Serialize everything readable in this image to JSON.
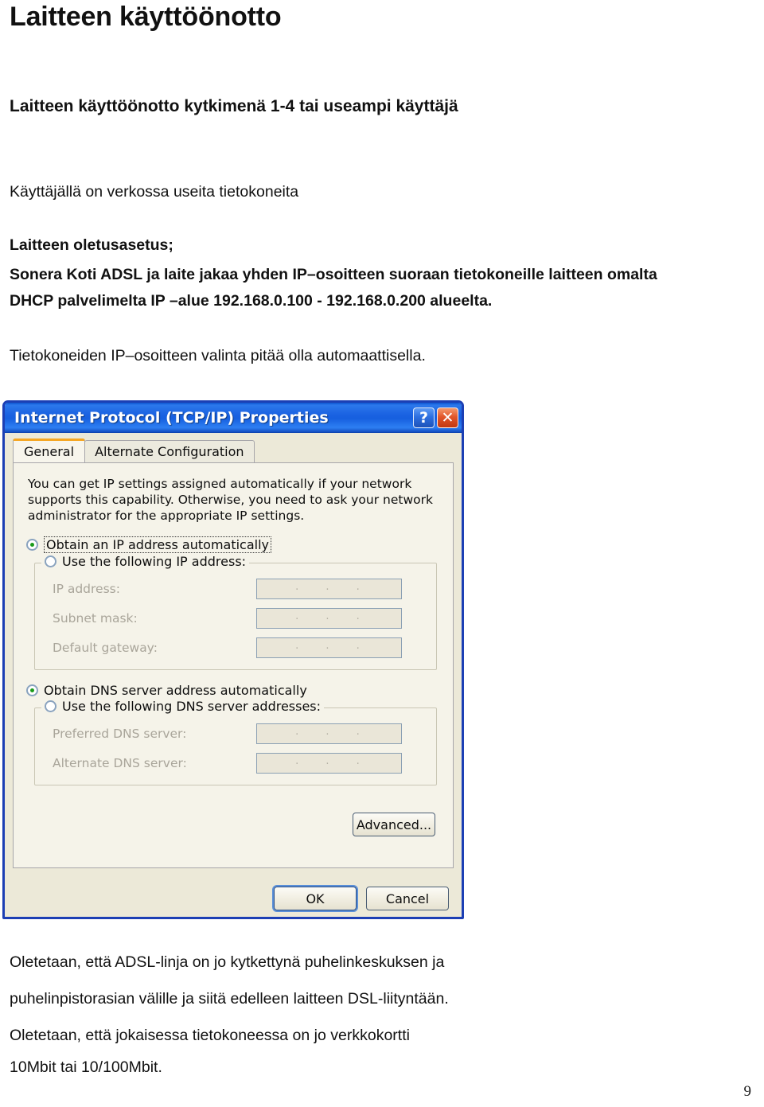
{
  "document": {
    "title": "Laitteen käyttöönotto",
    "heading": "Laitteen käyttöönotto kytkimenä 1-4 tai useampi käyttäjä",
    "paragraphs": {
      "useita": "Käyttäjällä on verkossa useita tietokoneita",
      "oletusasetus": "Laitteen oletusasetus;",
      "sonera": "Sonera Koti ADSL ja laite jakaa yhden IP–osoitteen suoraan tietokoneille  laitteen omalta",
      "dhcp": "DHCP palvelimelta IP –alue 192.168.0.100 - 192.168.0.200 alueelta.",
      "tietokoneiden": "Tietokoneiden IP–osoitteen valinta pitää olla automaattisella.",
      "bottom1": "Oletetaan, että ADSL-linja on jo kytkettynä puhelinkeskuksen ja",
      "bottom2": "puhelinpistorasian välille ja siitä edelleen laitteen DSL-liityntään.",
      "bottom3": "Oletetaan, että jokaisessa tietokoneessa on jo verkkokortti",
      "bottom4": "10Mbit tai 10/100Mbit."
    },
    "page_number": "9"
  },
  "dialog": {
    "title": "Internet Protocol (TCP/IP) Properties",
    "titlebar_buttons": {
      "help": "?",
      "close": "✕"
    },
    "tabs": [
      {
        "label": "General",
        "active": true
      },
      {
        "label": "Alternate Configuration",
        "active": false
      }
    ],
    "description": "You can get IP settings assigned automatically if your network supports this capability. Otherwise, you need to ask your network administrator for the appropriate IP settings.",
    "ip_section": {
      "obtain_auto_label": "Obtain an IP address automatically",
      "obtain_auto_selected": true,
      "use_following_label": "Use the following IP address:",
      "use_following_selected": false,
      "fields": [
        {
          "label": "IP address:",
          "value": ""
        },
        {
          "label": "Subnet mask:",
          "value": ""
        },
        {
          "label": "Default gateway:",
          "value": ""
        }
      ],
      "segment_separator": "."
    },
    "dns_section": {
      "obtain_auto_label": "Obtain DNS server address automatically",
      "obtain_auto_selected": true,
      "use_following_label": "Use the following DNS server addresses:",
      "use_following_selected": false,
      "fields": [
        {
          "label": "Preferred DNS server:",
          "value": ""
        },
        {
          "label": "Alternate DNS server:",
          "value": ""
        }
      ]
    },
    "buttons": {
      "advanced": "Advanced...",
      "ok": "OK",
      "cancel": "Cancel"
    },
    "colors": {
      "titlebar_blue": "#1b63e2",
      "dialog_face": "#ece9d8",
      "tab_active_accent": "#f5a623",
      "radio_dot_green": "#1a9b1a",
      "close_red": "#e2562a"
    }
  }
}
